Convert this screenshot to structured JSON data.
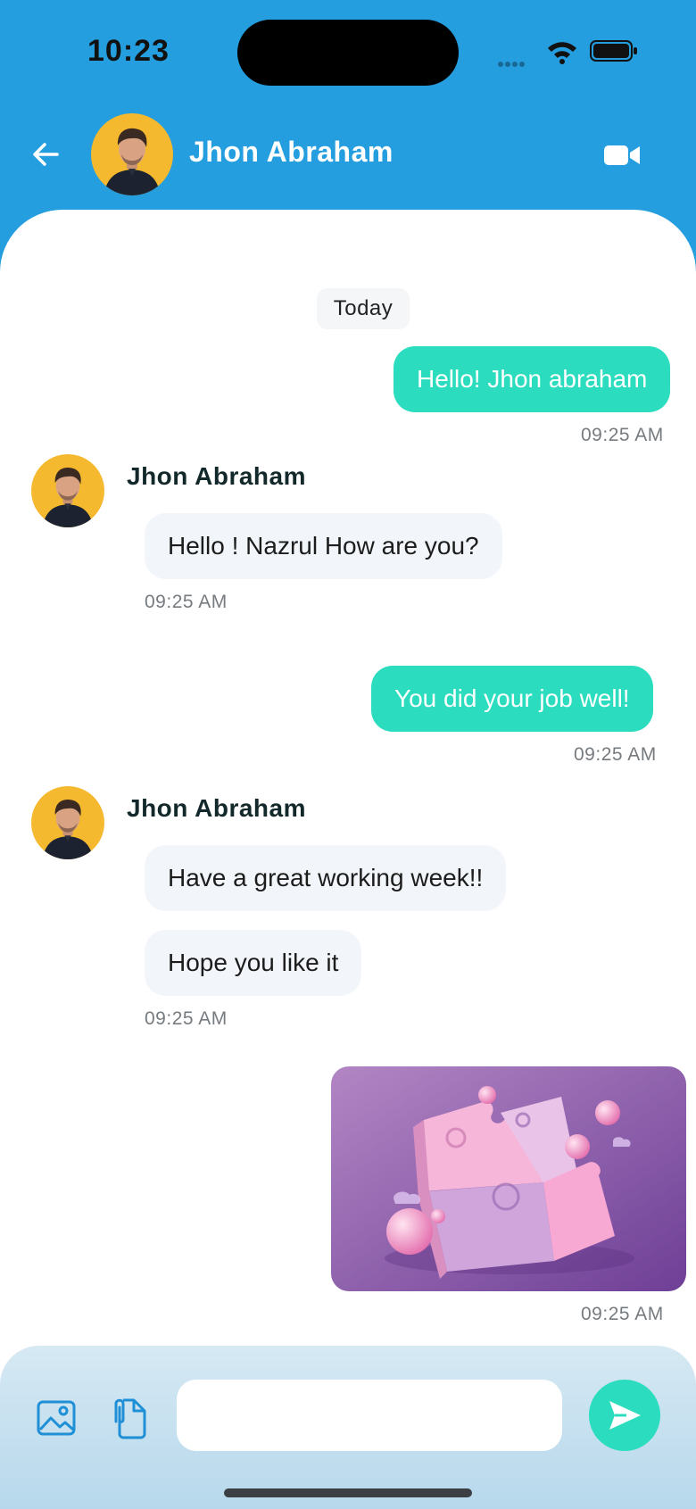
{
  "status_bar": {
    "time": "10:23"
  },
  "header": {
    "contact_name": "Jhon Abraham"
  },
  "chat": {
    "date_label": "Today",
    "messages": [
      {
        "text": "Hello! Jhon abraham",
        "time": "09:25 AM"
      },
      {
        "sender": "Jhon Abraham",
        "text": "Hello ! Nazrul How are you?",
        "time": "09:25 AM"
      },
      {
        "text": "You did your job well!",
        "time": "09:25 AM"
      },
      {
        "sender": "Jhon Abraham",
        "texts": [
          "Have a great working week!!",
          "Hope you like it"
        ],
        "time": "09:25 AM"
      },
      {
        "type": "image",
        "time": "09:25 AM"
      }
    ]
  },
  "composer": {
    "input_value": "",
    "placeholder": ""
  },
  "colors": {
    "header_bg": "#259EE0",
    "outgoing_bubble": "#2BDDBE",
    "incoming_bubble": "#F2F6FA",
    "avatar_bg": "#F4B92E"
  }
}
